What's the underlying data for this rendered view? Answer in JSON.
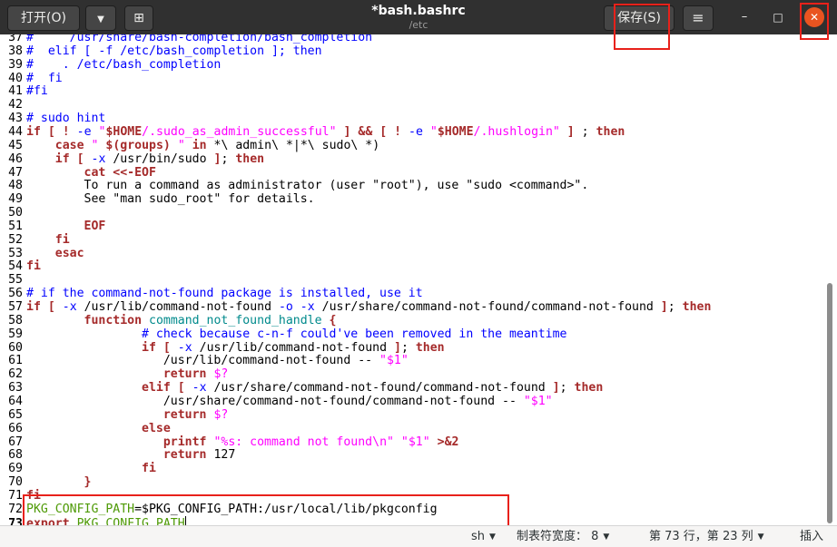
{
  "header": {
    "open_label": "打开(O)",
    "open_menu_icon": "▼",
    "new_tab_icon": "⊞",
    "title": "*bash.bashrc",
    "subtitle": "/etc",
    "save_label": "保存(S)",
    "menu_icon": "≡",
    "minimize_icon": "–",
    "maximize_icon": "□",
    "close_icon": "✕"
  },
  "editor": {
    "current_line": "73",
    "lines": [
      {
        "n": "37",
        "s": [
          [
            "c",
            "#     /usr/share/bash-completion/bash_completion"
          ]
        ]
      },
      {
        "n": "38",
        "s": [
          [
            "c",
            "#  elif [ -f /etc/bash_completion ]; then"
          ]
        ]
      },
      {
        "n": "39",
        "s": [
          [
            "c",
            "#    . /etc/bash_completion"
          ]
        ]
      },
      {
        "n": "40",
        "s": [
          [
            "c",
            "#  fi"
          ]
        ]
      },
      {
        "n": "41",
        "s": [
          [
            "c",
            "#fi"
          ]
        ]
      },
      {
        "n": "42",
        "s": []
      },
      {
        "n": "43",
        "s": [
          [
            "c",
            "# sudo hint"
          ]
        ]
      },
      {
        "n": "44",
        "s": [
          [
            "k",
            "if"
          ],
          [
            "t",
            " "
          ],
          [
            "k",
            "["
          ],
          [
            "t",
            " "
          ],
          [
            "k",
            "!"
          ],
          [
            "t",
            " "
          ],
          [
            "c",
            "-e"
          ],
          [
            "t",
            " "
          ],
          [
            "s",
            "\""
          ],
          [
            "k",
            "$HOME"
          ],
          [
            "s",
            "/.sudo_as_admin_successful\""
          ],
          [
            "t",
            " "
          ],
          [
            "k",
            "]"
          ],
          [
            "t",
            " "
          ],
          [
            "k",
            "&&"
          ],
          [
            "t",
            " "
          ],
          [
            "k",
            "["
          ],
          [
            "t",
            " "
          ],
          [
            "k",
            "!"
          ],
          [
            "t",
            " "
          ],
          [
            "c",
            "-e"
          ],
          [
            "t",
            " "
          ],
          [
            "s",
            "\""
          ],
          [
            "k",
            "$HOME"
          ],
          [
            "s",
            "/.hushlogin\""
          ],
          [
            "t",
            " "
          ],
          [
            "k",
            "]"
          ],
          [
            "t",
            " ; "
          ],
          [
            "k",
            "then"
          ]
        ]
      },
      {
        "n": "45",
        "s": [
          [
            "t",
            "    "
          ],
          [
            "k",
            "case"
          ],
          [
            "t",
            " "
          ],
          [
            "s",
            "\""
          ],
          [
            "t",
            " "
          ],
          [
            "k",
            "$(groups)"
          ],
          [
            "t",
            " "
          ],
          [
            "s",
            "\""
          ],
          [
            "t",
            " "
          ],
          [
            "k",
            "in"
          ],
          [
            "t",
            " *\\ admin\\ *|*\\ sudo\\ *)"
          ]
        ]
      },
      {
        "n": "46",
        "s": [
          [
            "t",
            "    "
          ],
          [
            "k",
            "if"
          ],
          [
            "t",
            " "
          ],
          [
            "k",
            "["
          ],
          [
            "t",
            " "
          ],
          [
            "c",
            "-x"
          ],
          [
            "t",
            " /usr/bin/sudo "
          ],
          [
            "k",
            "]"
          ],
          [
            "t",
            "; "
          ],
          [
            "k",
            "then"
          ]
        ]
      },
      {
        "n": "47",
        "s": [
          [
            "t",
            "        "
          ],
          [
            "k",
            "cat <<-EOF"
          ]
        ]
      },
      {
        "n": "48",
        "s": [
          [
            "t",
            "        To run a command as administrator (user \"root\"), use \"sudo <command>\"."
          ]
        ]
      },
      {
        "n": "49",
        "s": [
          [
            "t",
            "        See \"man sudo_root\" for details."
          ]
        ]
      },
      {
        "n": "50",
        "s": []
      },
      {
        "n": "51",
        "s": [
          [
            "t",
            "        "
          ],
          [
            "k",
            "EOF"
          ]
        ]
      },
      {
        "n": "52",
        "s": [
          [
            "t",
            "    "
          ],
          [
            "k",
            "fi"
          ]
        ]
      },
      {
        "n": "53",
        "s": [
          [
            "t",
            "    "
          ],
          [
            "k",
            "esac"
          ]
        ]
      },
      {
        "n": "54",
        "s": [
          [
            "k",
            "fi"
          ]
        ]
      },
      {
        "n": "55",
        "s": []
      },
      {
        "n": "56",
        "s": [
          [
            "c",
            "# if the command-not-found package is installed, use it"
          ]
        ]
      },
      {
        "n": "57",
        "s": [
          [
            "k",
            "if"
          ],
          [
            "t",
            " "
          ],
          [
            "k",
            "["
          ],
          [
            "t",
            " "
          ],
          [
            "c",
            "-x"
          ],
          [
            "t",
            " /usr/lib/command-not-found "
          ],
          [
            "c",
            "-o"
          ],
          [
            "t",
            " "
          ],
          [
            "c",
            "-x"
          ],
          [
            "t",
            " /usr/share/command-not-found/command-not-found "
          ],
          [
            "k",
            "]"
          ],
          [
            "t",
            "; "
          ],
          [
            "k",
            "then"
          ]
        ]
      },
      {
        "n": "58",
        "s": [
          [
            "t",
            "        "
          ],
          [
            "k",
            "function"
          ],
          [
            "t",
            " "
          ],
          [
            "v",
            "command_not_found_handle"
          ],
          [
            "t",
            " "
          ],
          [
            "k",
            "{"
          ]
        ]
      },
      {
        "n": "59",
        "s": [
          [
            "t",
            "                "
          ],
          [
            "c",
            "# check because c-n-f could've been removed in the meantime"
          ]
        ]
      },
      {
        "n": "60",
        "s": [
          [
            "t",
            "                "
          ],
          [
            "k",
            "if"
          ],
          [
            "t",
            " "
          ],
          [
            "k",
            "["
          ],
          [
            "t",
            " "
          ],
          [
            "c",
            "-x"
          ],
          [
            "t",
            " /usr/lib/command-not-found "
          ],
          [
            "k",
            "]"
          ],
          [
            "t",
            "; "
          ],
          [
            "k",
            "then"
          ]
        ]
      },
      {
        "n": "61",
        "s": [
          [
            "t",
            "                   /usr/lib/command-not-found -- "
          ],
          [
            "s",
            "\"$1\""
          ]
        ]
      },
      {
        "n": "62",
        "s": [
          [
            "t",
            "                   "
          ],
          [
            "k",
            "return"
          ],
          [
            "t",
            " "
          ],
          [
            "s",
            "$?"
          ]
        ]
      },
      {
        "n": "63",
        "s": [
          [
            "t",
            "                "
          ],
          [
            "k",
            "elif"
          ],
          [
            "t",
            " "
          ],
          [
            "k",
            "["
          ],
          [
            "t",
            " "
          ],
          [
            "c",
            "-x"
          ],
          [
            "t",
            " /usr/share/command-not-found/command-not-found "
          ],
          [
            "k",
            "]"
          ],
          [
            "t",
            "; "
          ],
          [
            "k",
            "then"
          ]
        ]
      },
      {
        "n": "64",
        "s": [
          [
            "t",
            "                   /usr/share/command-not-found/command-not-found -- "
          ],
          [
            "s",
            "\"$1\""
          ]
        ]
      },
      {
        "n": "65",
        "s": [
          [
            "t",
            "                   "
          ],
          [
            "k",
            "return"
          ],
          [
            "t",
            " "
          ],
          [
            "s",
            "$?"
          ]
        ]
      },
      {
        "n": "66",
        "s": [
          [
            "t",
            "                "
          ],
          [
            "k",
            "else"
          ]
        ]
      },
      {
        "n": "67",
        "s": [
          [
            "t",
            "                   "
          ],
          [
            "k",
            "printf"
          ],
          [
            "t",
            " "
          ],
          [
            "s",
            "\"%s: command not found\\n\""
          ],
          [
            "t",
            " "
          ],
          [
            "s",
            "\"$1\""
          ],
          [
            "t",
            " "
          ],
          [
            "k",
            ">&2"
          ]
        ]
      },
      {
        "n": "68",
        "s": [
          [
            "t",
            "                   "
          ],
          [
            "k",
            "return"
          ],
          [
            "t",
            " 127"
          ]
        ]
      },
      {
        "n": "69",
        "s": [
          [
            "t",
            "                "
          ],
          [
            "k",
            "fi"
          ]
        ]
      },
      {
        "n": "70",
        "s": [
          [
            "t",
            "        "
          ],
          [
            "k",
            "}"
          ]
        ]
      },
      {
        "n": "71",
        "s": [
          [
            "k",
            "fi"
          ]
        ]
      },
      {
        "n": "72",
        "s": [
          [
            "ex",
            "PKG_CONFIG_PATH"
          ],
          [
            "t",
            "=$PKG_CONFIG_PATH:/usr/local/lib/pkgconfig"
          ]
        ]
      },
      {
        "n": "73",
        "s": [
          [
            "k",
            "export"
          ],
          [
            "t",
            " "
          ],
          [
            "ex",
            "PKG_CONFIG_PATH"
          ]
        ]
      }
    ]
  },
  "status": {
    "language": "sh",
    "tab_width": "制表符宽度： 8",
    "position": "第 73 行，第 23 列",
    "mode": "插入"
  },
  "colors": {
    "headerbar": "#303030",
    "close_button": "#e95420",
    "highlight_box": "#e8211a",
    "comment": "#0000ff",
    "keyword": "#a52a2a",
    "string": "#ff00ff",
    "export_var": "#4e9a06"
  }
}
